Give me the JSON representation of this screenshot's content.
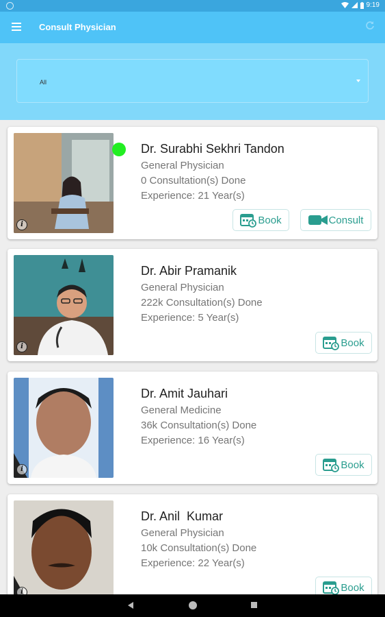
{
  "status_bar": {
    "time": "9:19"
  },
  "app_bar": {
    "title": "Consult Physician"
  },
  "filter": {
    "selected": "All"
  },
  "doctors": [
    {
      "name": "Dr. Surabhi Sekhri Tandon",
      "specialty": "General Physician",
      "consultations": "0 Consultation(s) Done",
      "experience": "Experience: 21 Year(s)",
      "online": true,
      "book_label": "Book",
      "consult_label": "Consult"
    },
    {
      "name": "Dr. Abir Pramanik",
      "specialty": "General Physician",
      "consultations": "222k Consultation(s) Done",
      "experience": "Experience: 5 Year(s)",
      "online": false,
      "book_label": "Book"
    },
    {
      "name": "Dr. Amit Jauhari",
      "specialty": "General Medicine",
      "consultations": "36k Consultation(s) Done",
      "experience": "Experience: 16 Year(s)",
      "online": false,
      "book_label": "Book"
    },
    {
      "name": "Dr. Anil  Kumar",
      "specialty": "General Physician",
      "consultations": "10k Consultation(s) Done",
      "experience": "Experience: 22 Year(s)",
      "online": false,
      "book_label": "Book"
    }
  ],
  "colors": {
    "status_bar": "#3aa6de",
    "app_bar": "#4fc3f7",
    "header": "#81d8fa",
    "accent": "#2a9d8f",
    "online": "#22ee22"
  }
}
